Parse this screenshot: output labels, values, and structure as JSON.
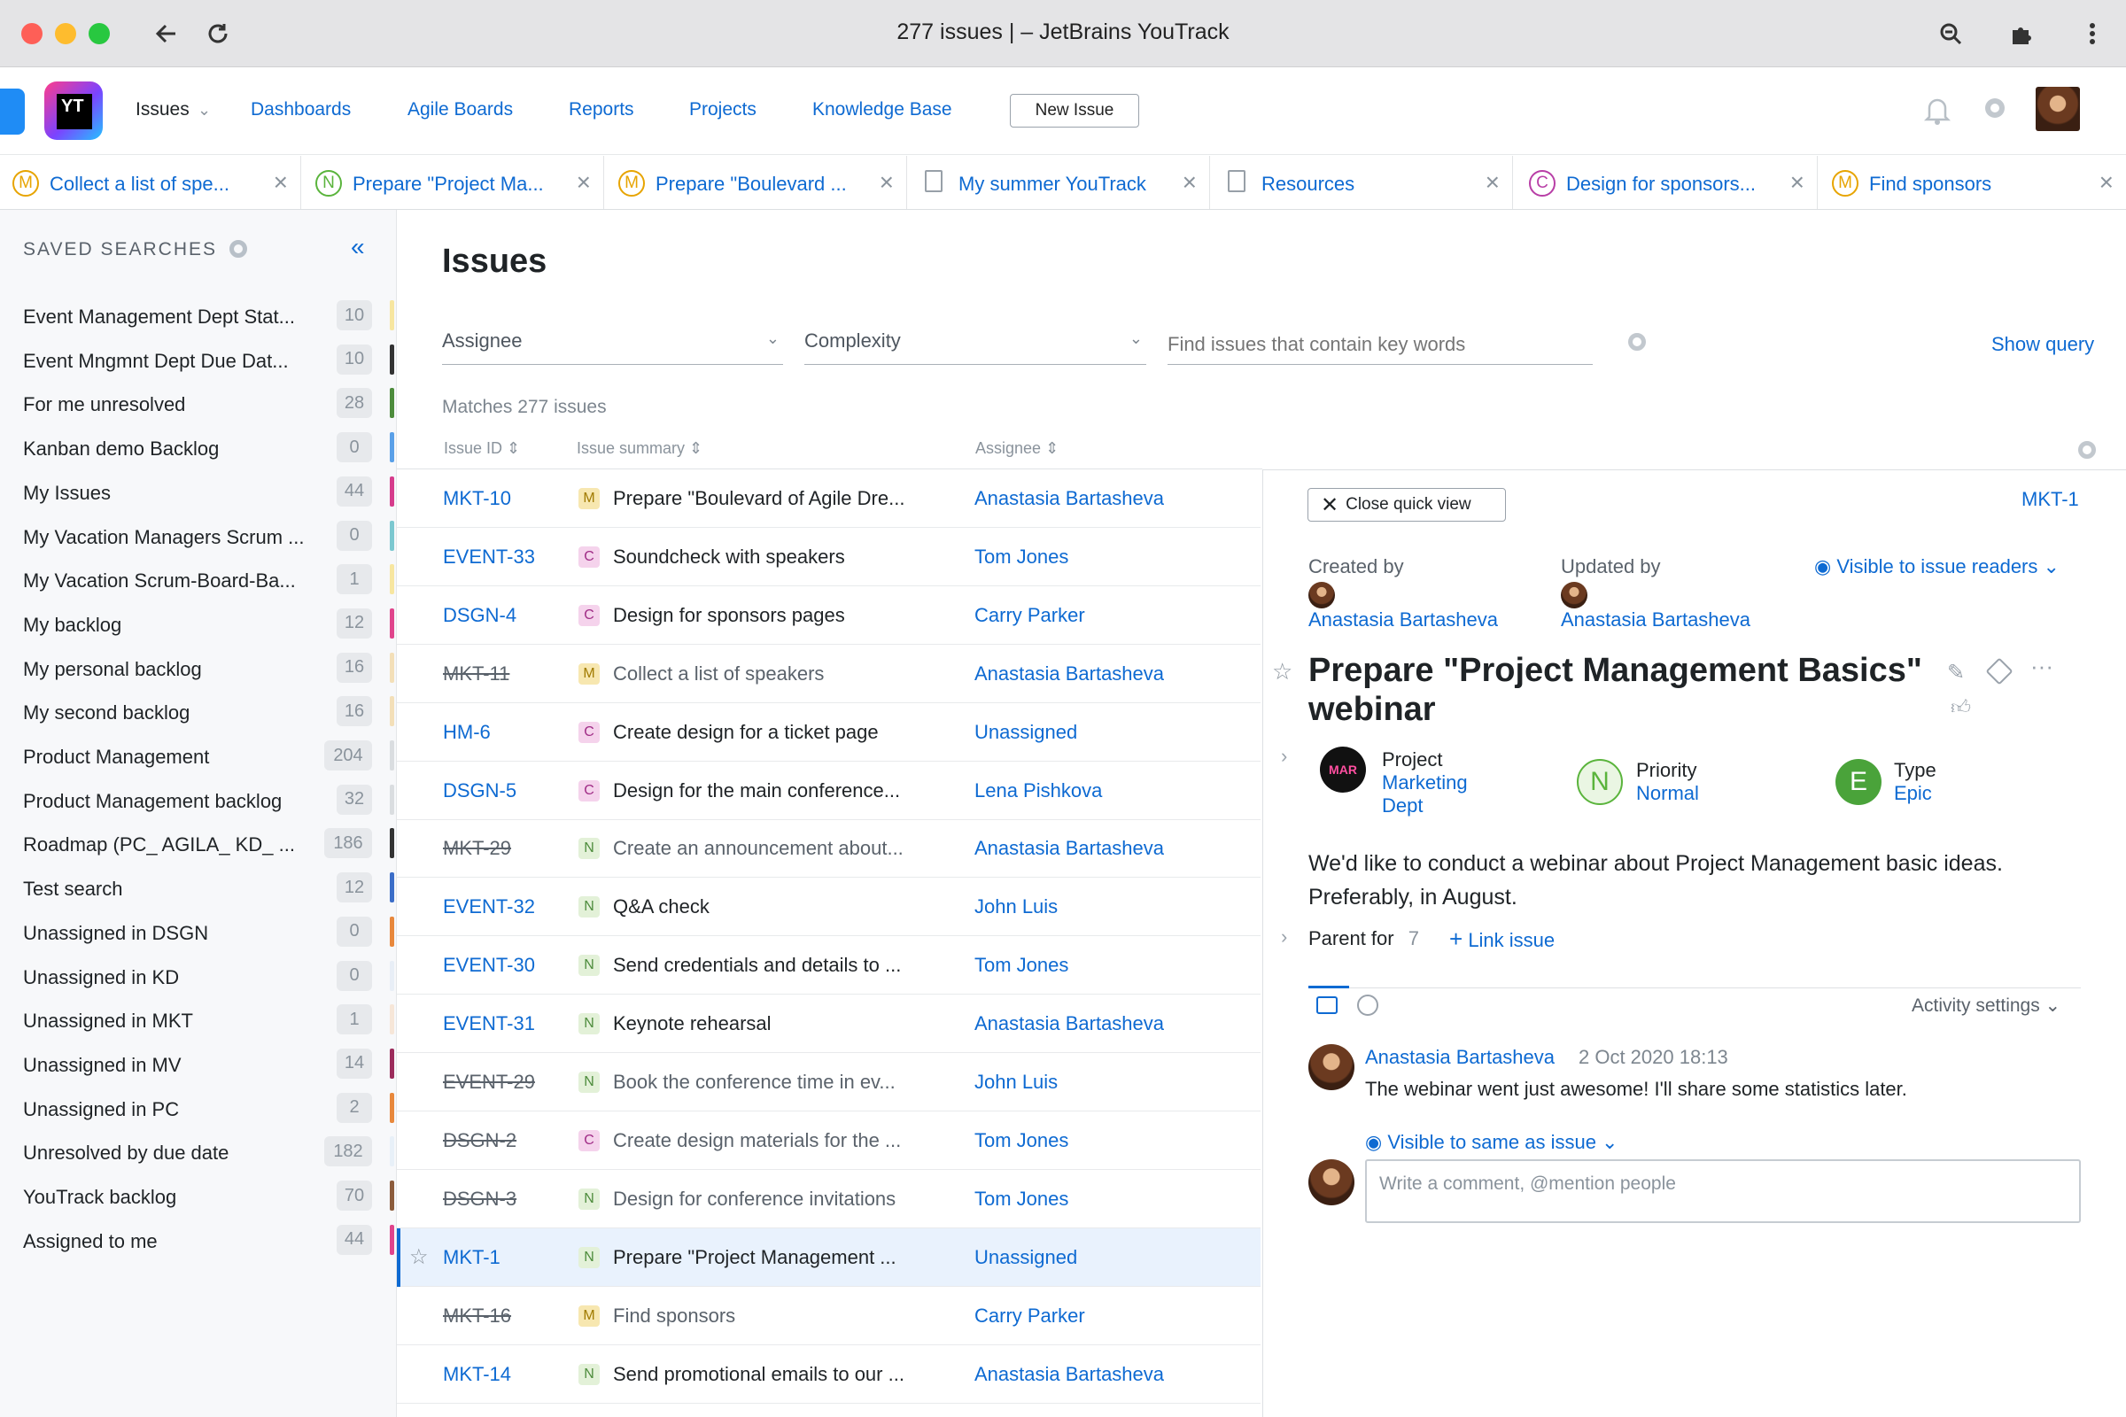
{
  "window": {
    "title": "277 issues | – JetBrains YouTrack"
  },
  "header": {
    "logo": "YT",
    "nav": [
      "Issues",
      "Dashboards",
      "Agile Boards",
      "Reports",
      "Projects",
      "Knowledge Base"
    ],
    "new_issue": "New Issue"
  },
  "tabs": [
    {
      "letter": "M",
      "label": "Collect a list of spe...",
      "color": "#e7a400"
    },
    {
      "letter": "N",
      "label": "Prepare \"Project Ma...",
      "color": "#5ab43c"
    },
    {
      "letter": "M",
      "label": "Prepare \"Boulevard ...",
      "color": "#e7a400"
    },
    {
      "letter": "",
      "label": "My summer YouTrack",
      "color": ""
    },
    {
      "letter": "",
      "label": "Resources",
      "color": ""
    },
    {
      "letter": "C",
      "label": "Design for sponsors...",
      "color": "#b83ea6"
    },
    {
      "letter": "M",
      "label": "Find sponsors",
      "color": "#e7a400"
    }
  ],
  "sidebar": {
    "title": "SAVED SEARCHES",
    "items": [
      {
        "name": "Event Management Dept Stat...",
        "count": "10",
        "color": "#f7e6a0"
      },
      {
        "name": "Event Mngmnt Dept Due Dat...",
        "count": "10",
        "color": "#333333"
      },
      {
        "name": "For me unresolved",
        "count": "28",
        "color": "#4d8c3c"
      },
      {
        "name": "Kanban demo Backlog",
        "count": "0",
        "color": "#5aa0e8"
      },
      {
        "name": "My Issues",
        "count": "44",
        "color": "#d63c8c"
      },
      {
        "name": "My Vacation Managers Scrum ...",
        "count": "0",
        "color": "#7cc8d0"
      },
      {
        "name": "My Vacation Scrum-Board-Ba...",
        "count": "1",
        "color": "#f7e6a0"
      },
      {
        "name": "My backlog",
        "count": "12",
        "color": "#e0458c"
      },
      {
        "name": "My personal backlog",
        "count": "16",
        "color": "#f3dfb8"
      },
      {
        "name": "My second backlog",
        "count": "16",
        "color": "#f3dfb8"
      },
      {
        "name": "Product Management",
        "count": "204",
        "color": "#dadde0"
      },
      {
        "name": "Product Management backlog",
        "count": "32",
        "color": "#dadde0"
      },
      {
        "name": "Roadmap (PC_ AGILA_ KD_ ...",
        "count": "186",
        "color": "#333333"
      },
      {
        "name": "Test search",
        "count": "12",
        "color": "#3c6ec8"
      },
      {
        "name": "Unassigned in DSGN",
        "count": "0",
        "color": "#e8883c"
      },
      {
        "name": "Unassigned in KD",
        "count": "0",
        "color": "#e8eef6"
      },
      {
        "name": "Unassigned in MKT",
        "count": "1",
        "color": "#f6e6d8"
      },
      {
        "name": "Unassigned in MV",
        "count": "14",
        "color": "#9c2c5c"
      },
      {
        "name": "Unassigned in PC",
        "count": "2",
        "color": "#e8883c"
      },
      {
        "name": "Unresolved by due date",
        "count": "182",
        "color": "#e8f0f8"
      },
      {
        "name": "YouTrack backlog",
        "count": "70",
        "color": "#8c5c3c"
      },
      {
        "name": "Assigned to me",
        "count": "44",
        "color": "#e0458c"
      }
    ]
  },
  "main": {
    "title": "Issues",
    "filters": {
      "assignee": "Assignee",
      "complexity": "Complexity",
      "search_placeholder": "Find issues that contain key words"
    },
    "show_query": "Show query",
    "matches": "Matches 277 issues",
    "columns": [
      "Issue ID",
      "Issue summary",
      "Assignee"
    ],
    "rows": [
      {
        "id": "MKT-10",
        "type": "M",
        "summary": "Prepare \"Boulevard of Agile Dre...",
        "assignee": "Anastasia Bartasheva",
        "resolved": false
      },
      {
        "id": "EVENT-33",
        "type": "C",
        "summary": "Soundcheck with speakers",
        "assignee": "Tom Jones",
        "resolved": false
      },
      {
        "id": "DSGN-4",
        "type": "C",
        "summary": "Design for sponsors pages",
        "assignee": "Carry Parker",
        "resolved": false
      },
      {
        "id": "MKT-11",
        "type": "M",
        "summary": "Collect a list of speakers",
        "assignee": "Anastasia Bartasheva",
        "resolved": true
      },
      {
        "id": "HM-6",
        "type": "C",
        "summary": "Create design for a ticket page",
        "assignee": "Unassigned",
        "resolved": false
      },
      {
        "id": "DSGN-5",
        "type": "C",
        "summary": "Design for the main conference...",
        "assignee": "Lena Pishkova",
        "resolved": false
      },
      {
        "id": "MKT-29",
        "type": "N",
        "summary": "Create an announcement about...",
        "assignee": "Anastasia Bartasheva",
        "resolved": true
      },
      {
        "id": "EVENT-32",
        "type": "N",
        "summary": "Q&A check",
        "assignee": "John Luis",
        "resolved": false
      },
      {
        "id": "EVENT-30",
        "type": "N",
        "summary": "Send credentials and details to ...",
        "assignee": "Tom Jones",
        "resolved": false
      },
      {
        "id": "EVENT-31",
        "type": "N",
        "summary": "Keynote rehearsal",
        "assignee": "Anastasia Bartasheva",
        "resolved": false
      },
      {
        "id": "EVENT-29",
        "type": "N",
        "summary": "Book the conference time in ev...",
        "assignee": "John Luis",
        "resolved": true
      },
      {
        "id": "DSGN-2",
        "type": "C",
        "summary": "Create design materials for the ...",
        "assignee": "Tom Jones",
        "resolved": true
      },
      {
        "id": "DSGN-3",
        "type": "N",
        "summary": "Design for conference invitations",
        "assignee": "Tom Jones",
        "resolved": true
      },
      {
        "id": "MKT-1",
        "type": "N",
        "summary": "Prepare \"Project Management ...",
        "assignee": "Unassigned",
        "resolved": false,
        "selected": true
      },
      {
        "id": "MKT-16",
        "type": "M",
        "summary": "Find sponsors",
        "assignee": "Carry Parker",
        "resolved": true
      },
      {
        "id": "MKT-14",
        "type": "N",
        "summary": "Send promotional emails to our ...",
        "assignee": "Anastasia Bartasheva",
        "resolved": false
      }
    ]
  },
  "quickview": {
    "close": "Close quick view",
    "issue_id": "MKT-1",
    "created_by_label": "Created by",
    "created_by": "Anastasia Bartasheva",
    "updated_by_label": "Updated by",
    "updated_by": "Anastasia Bartasheva",
    "visibility": "Visible to issue readers",
    "title": "Prepare \"Project Management Basics\" webinar",
    "fields": {
      "project_label": "Project",
      "project_badge": "MAR",
      "project_value": "Marketing Dept",
      "priority_label": "Priority",
      "priority_letter": "N",
      "priority_value": "Normal",
      "type_label": "Type",
      "type_letter": "E",
      "type_value": "Epic"
    },
    "description": "We'd like to conduct a webinar about Project Management basic ideas. Preferably, in August.",
    "parent_for_label": "Parent for",
    "parent_for_count": "7",
    "link_issue": "Link issue",
    "activity_settings": "Activity settings",
    "comment": {
      "author": "Anastasia Bartasheva",
      "date": "2 Oct 2020 18:13",
      "text": "The webinar went just awesome! I'll share some statistics later."
    },
    "comment_visibility": "Visible to same as issue",
    "comment_placeholder": "Write a comment, @mention people"
  },
  "colors": {
    "link": "#0e6ad2",
    "type_M": "#f7e7b0",
    "type_C": "#f5d3ec",
    "type_N": "#e3f1d8"
  }
}
